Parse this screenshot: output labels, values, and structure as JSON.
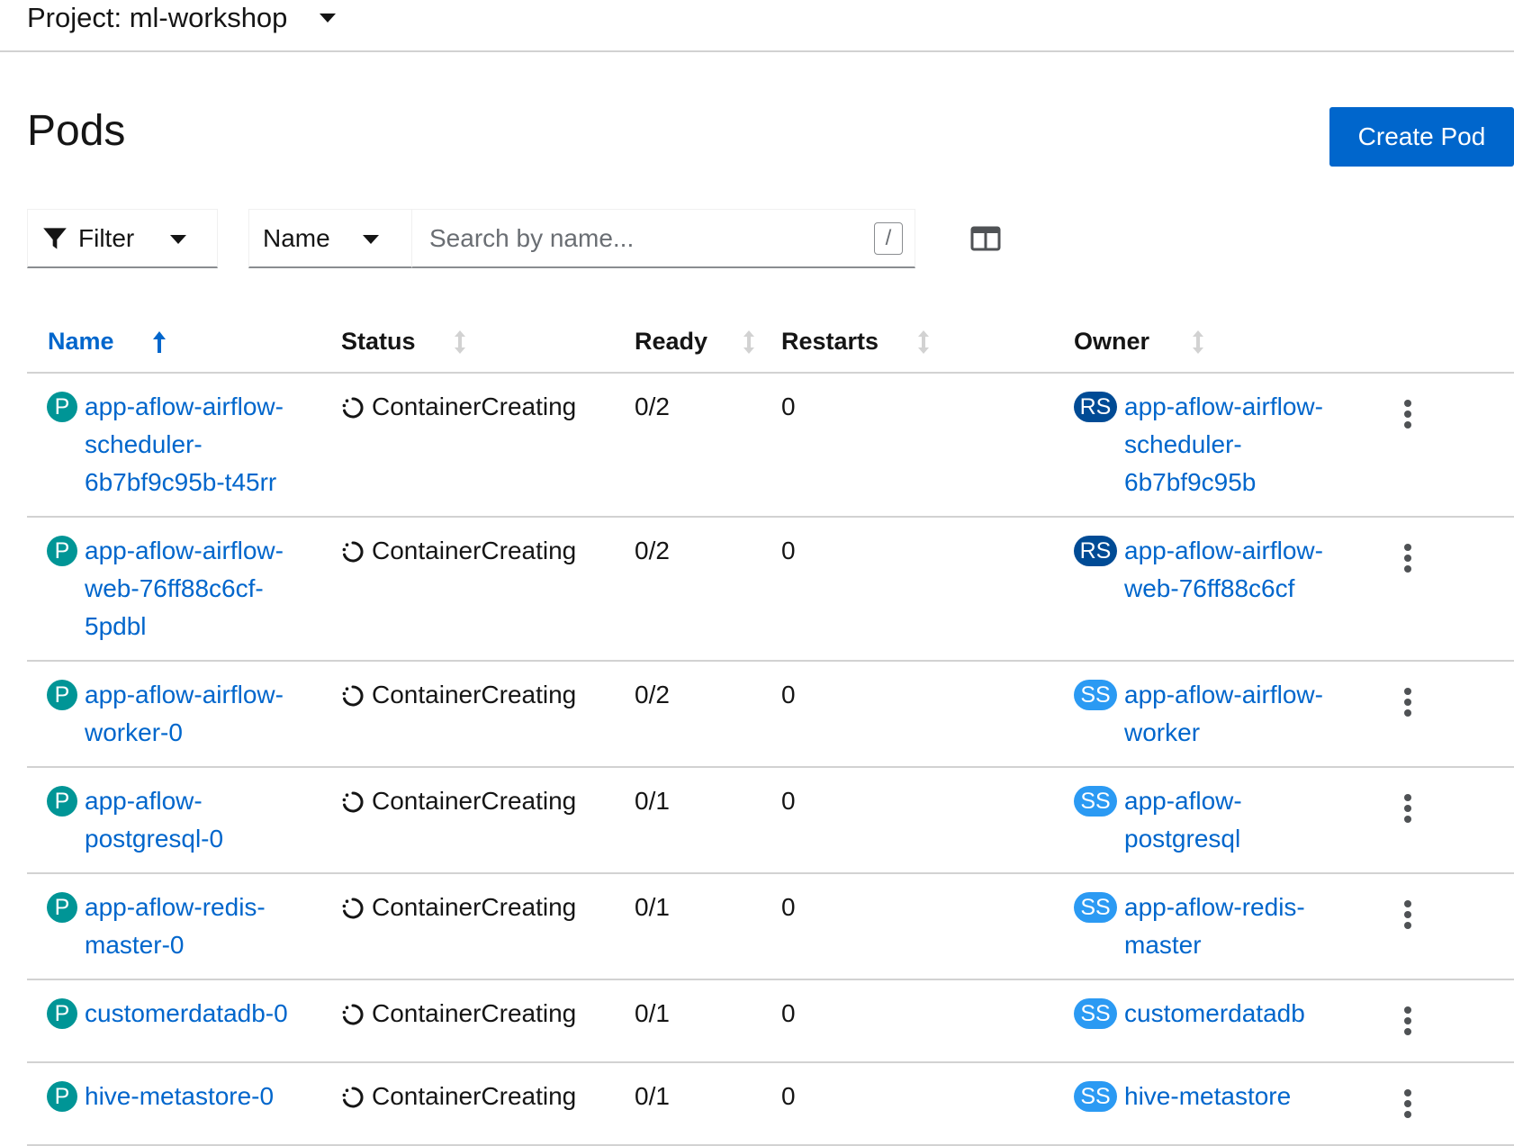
{
  "project_bar": {
    "label": "Project: ml-workshop"
  },
  "page": {
    "title": "Pods",
    "create_button": "Create Pod"
  },
  "toolbar": {
    "filter_label": "Filter",
    "search_type_label": "Name",
    "search_placeholder": "Search by name...",
    "search_value": "",
    "shortcut_hint": "/"
  },
  "table": {
    "columns": [
      {
        "label": "Name",
        "sorted": true,
        "direction": "ascending"
      },
      {
        "label": "Status"
      },
      {
        "label": "Ready"
      },
      {
        "label": "Restarts"
      },
      {
        "label": "Owner"
      }
    ],
    "rows": [
      {
        "name_lines": [
          "app-aflow-airflow-",
          "scheduler-",
          "6b7bf9c95b-t45rr"
        ],
        "status": "ContainerCreating",
        "ready": "0/2",
        "restarts": "0",
        "owner_badge": "RS",
        "owner_lines": [
          "app-aflow-airflow-",
          "scheduler-",
          "6b7bf9c95b"
        ]
      },
      {
        "name_lines": [
          "app-aflow-airflow-",
          "web-76ff88c6cf-",
          "5pdbl"
        ],
        "status": "ContainerCreating",
        "ready": "0/2",
        "restarts": "0",
        "owner_badge": "RS",
        "owner_lines": [
          "app-aflow-airflow-",
          "web-76ff88c6cf"
        ]
      },
      {
        "name_lines": [
          "app-aflow-airflow-",
          "worker-0"
        ],
        "status": "ContainerCreating",
        "ready": "0/2",
        "restarts": "0",
        "owner_badge": "SS",
        "owner_lines": [
          "app-aflow-airflow-",
          "worker"
        ]
      },
      {
        "name_lines": [
          "app-aflow-",
          "postgresql-0"
        ],
        "status": "ContainerCreating",
        "ready": "0/1",
        "restarts": "0",
        "owner_badge": "SS",
        "owner_lines": [
          "app-aflow-",
          "postgresql"
        ]
      },
      {
        "name_lines": [
          "app-aflow-redis-",
          "master-0"
        ],
        "status": "ContainerCreating",
        "ready": "0/1",
        "restarts": "0",
        "owner_badge": "SS",
        "owner_lines": [
          "app-aflow-redis-",
          "master"
        ]
      },
      {
        "name_lines": [
          "customerdatadb-0"
        ],
        "status": "ContainerCreating",
        "ready": "0/1",
        "restarts": "0",
        "owner_badge": "SS",
        "owner_lines": [
          "customerdatadb"
        ]
      },
      {
        "name_lines": [
          "hive-metastore-0"
        ],
        "status": "ContainerCreating",
        "ready": "0/1",
        "restarts": "0",
        "owner_badge": "SS",
        "owner_lines": [
          "hive-metastore"
        ]
      }
    ],
    "pod_badge": "P"
  },
  "colors": {
    "link": "#0066cc",
    "primary_button": "#0066cc",
    "badge_pod": "#009596",
    "badge_replicaset": "#004b95",
    "badge_statefulset": "#2b9af3"
  },
  "icons": {
    "filter": "filter-icon",
    "columns": "columns-icon",
    "sort_asc": "sort-ascending-icon",
    "sort": "sort-icon",
    "status": "in-progress-icon",
    "kebab": "kebab-icon"
  }
}
